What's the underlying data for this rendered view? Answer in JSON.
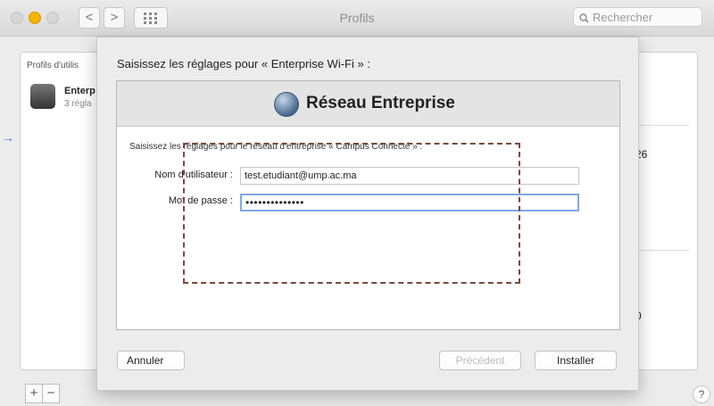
{
  "window": {
    "title": "Profils",
    "search_placeholder": "Rechercher",
    "nav_back": "<",
    "nav_forward": ">"
  },
  "background": {
    "list_header": "Profils d'utilis",
    "profile_name": "Enterp",
    "profile_sub": "3 régla",
    "right_value_1": "26",
    "right_value_2": "0",
    "add_label": "+",
    "remove_label": "−",
    "help_label": "?",
    "arrow": "→"
  },
  "sheet": {
    "prompt": "Saisissez les réglages pour « Enterprise Wi-Fi » :",
    "network_title": "Réseau Entreprise",
    "settings_prompt": "Saisissez les réglages pour le réseau d'entreprise « Campus Connecté » :",
    "username_label": "Nom d'utilisateur :",
    "username_value": "test.etudiant@ump.ac.ma",
    "password_label": "Mot de passe :",
    "password_value": "••••••••••••••",
    "cancel_label": "Annuler",
    "previous_label": "Précédent",
    "install_label": "Installer"
  },
  "colors": {
    "focus_ring": "#7fa9e5",
    "annotation_dash": "#7a4a3a",
    "minimize_light": "#f4b400"
  }
}
